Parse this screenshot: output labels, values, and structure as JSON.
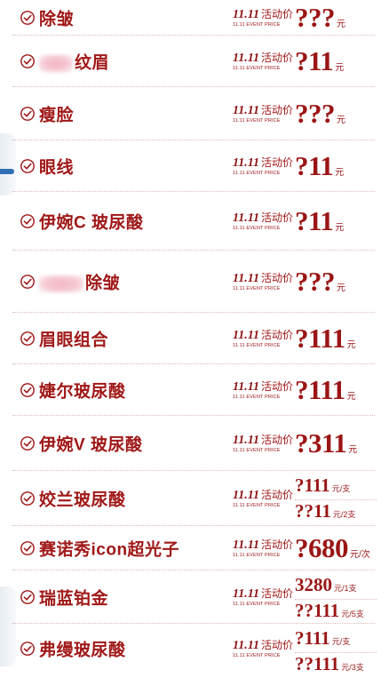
{
  "event_label": {
    "date": "11.11",
    "cn": "活动价",
    "en": "11.11 EVENT PRICE"
  },
  "icons": {
    "check": "check-circle-icon"
  },
  "colors": {
    "brand": "#a01818",
    "divider": "#d9b9b9",
    "blur": "#f2b5c2"
  },
  "items": [
    {
      "name": "除皱",
      "price": "???",
      "unit": "元"
    },
    {
      "name": "纹眉",
      "name_prefix_blurred": true,
      "price": "?11",
      "unit": "元"
    },
    {
      "name": "瘦脸",
      "price": "???",
      "unit": "元"
    },
    {
      "name": "眼线",
      "price": "?11",
      "unit": "元"
    },
    {
      "name": "伊婉C 玻尿酸",
      "price": "?11",
      "unit": "元"
    },
    {
      "name": "除皱",
      "name_prefix_blurred": true,
      "price": "???",
      "unit": "元"
    },
    {
      "name": "眉眼组合",
      "price": "?111",
      "unit": "元"
    },
    {
      "name": "婕尔玻尿酸",
      "price": "?111",
      "unit": "元"
    },
    {
      "name": "伊婉V 玻尿酸",
      "price": "?311",
      "unit": "元"
    },
    {
      "name": "姣兰玻尿酸",
      "prices": [
        {
          "price": "?111",
          "unit": "元/支"
        },
        {
          "price": "??11",
          "unit": "元/2支"
        }
      ]
    },
    {
      "name": "赛诺秀icon超光子",
      "price": "?680",
      "unit": "元/次"
    },
    {
      "name": "瑞蓝铂金",
      "prices": [
        {
          "price": "3280",
          "unit": "元/1支"
        },
        {
          "price": "??111",
          "unit": "元/5支"
        }
      ]
    },
    {
      "name": "弗缦玻尿酸",
      "prices": [
        {
          "price": "?111",
          "unit": "元/支"
        },
        {
          "price": "??111",
          "unit": "元/3支"
        }
      ]
    }
  ]
}
